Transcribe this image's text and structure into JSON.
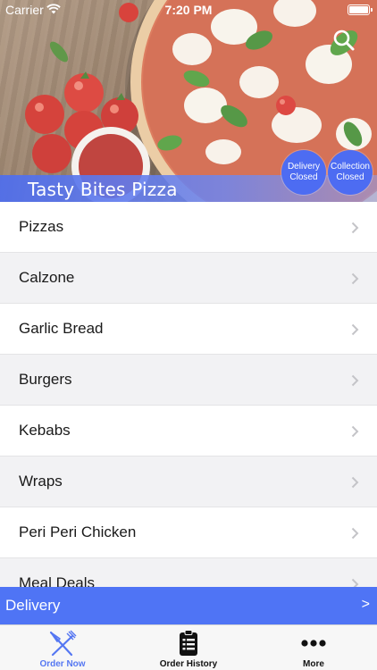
{
  "status_bar": {
    "carrier": "Carrier",
    "time": "7:20 PM"
  },
  "hero": {
    "store_name": "Tasty Bites Pizza",
    "delivery_status": {
      "line1": "Delivery",
      "line2": "Closed"
    },
    "collection_status": {
      "line1": "Collection",
      "line2": "Closed"
    }
  },
  "categories": [
    {
      "label": "Pizzas"
    },
    {
      "label": "Calzone"
    },
    {
      "label": "Garlic Bread"
    },
    {
      "label": "Burgers"
    },
    {
      "label": "Kebabs"
    },
    {
      "label": "Wraps"
    },
    {
      "label": "Peri Peri Chicken"
    },
    {
      "label": "Meal Deals"
    }
  ],
  "delivery_bar": {
    "label": "Delivery",
    "arrow": ">"
  },
  "tabs": [
    {
      "label": "Order Now",
      "icon": "fork-knife-icon",
      "active": true
    },
    {
      "label": "Order History",
      "icon": "clipboard-list-icon",
      "active": false
    },
    {
      "label": "More",
      "icon": "more-dots-icon",
      "active": false
    }
  ],
  "colors": {
    "accent": "#4f74f5",
    "status_circle": "#4d6cf2",
    "active_tab": "#5577f2"
  }
}
